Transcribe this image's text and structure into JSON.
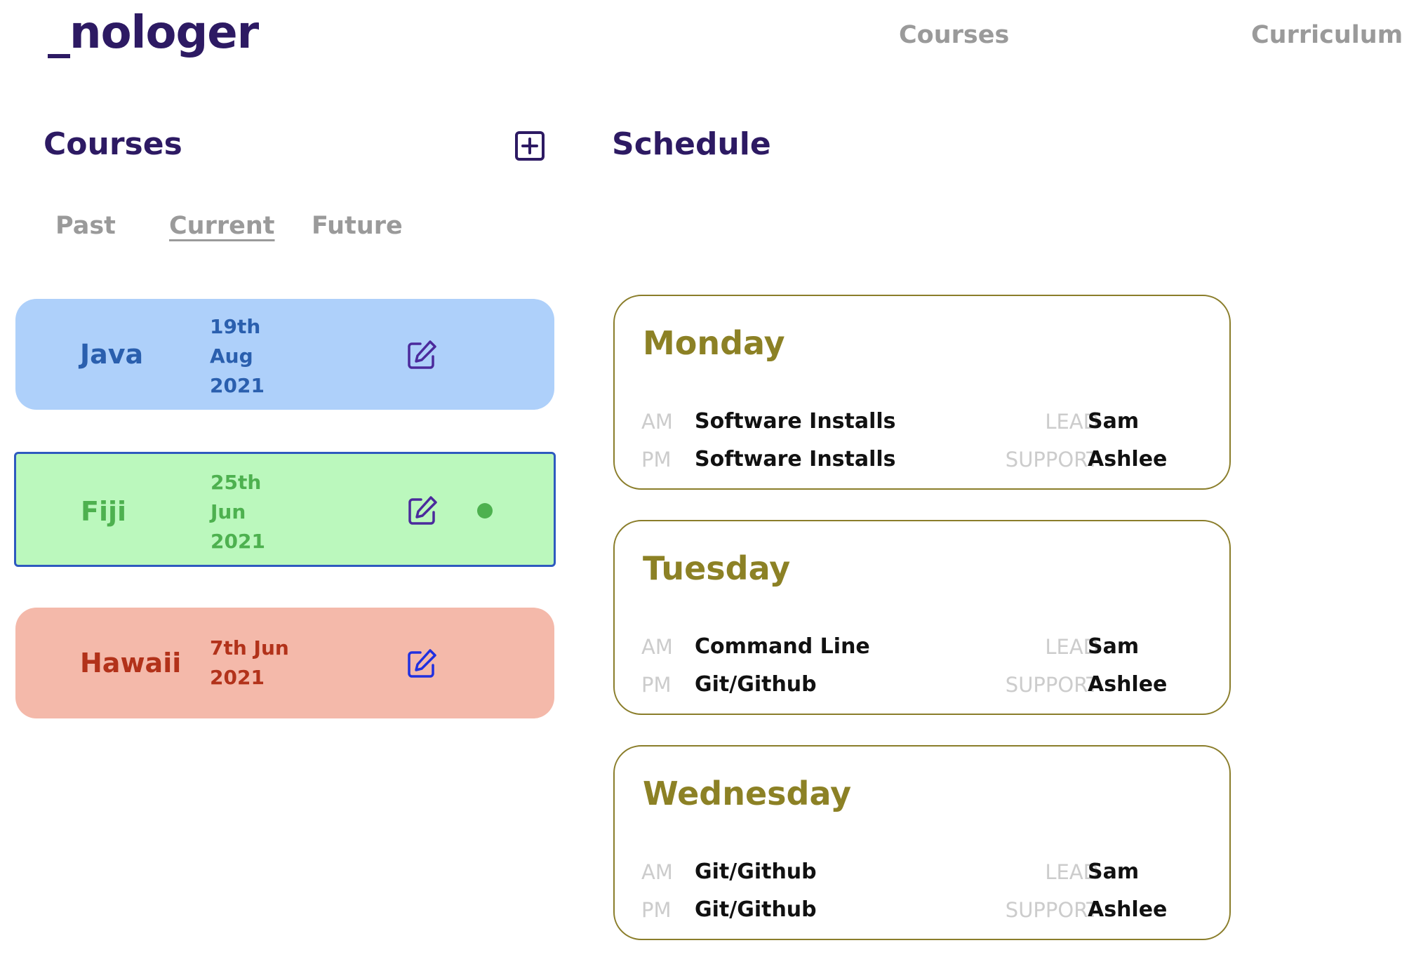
{
  "header": {
    "logo": "_nologer",
    "nav": {
      "courses": "Courses",
      "curriculum": "Curriculum"
    }
  },
  "courses_panel": {
    "title": "Courses",
    "tabs": {
      "past": "Past",
      "current": "Current",
      "future": "Future"
    },
    "cards": [
      {
        "name": "Java",
        "date_line1": "19th",
        "date_line2": "Aug",
        "date_line3": "2021"
      },
      {
        "name": "Fiji",
        "date_line1": "25th",
        "date_line2": "Jun",
        "date_line3": "2021"
      },
      {
        "name": "Hawaii",
        "date_line1": "7th Jun",
        "date_line2": "2021"
      }
    ]
  },
  "schedule": {
    "title": "Schedule",
    "labels": {
      "am": "AM",
      "pm": "PM",
      "lead": "LEAD",
      "support": "SUPPORT"
    },
    "days": [
      {
        "day": "Monday",
        "am": "Software Installs",
        "pm": "Software Installs",
        "lead": "Sam",
        "support": "Ashlee"
      },
      {
        "day": "Tuesday",
        "am": "Command Line",
        "pm": "Git/Github",
        "lead": "Sam",
        "support": "Ashlee"
      },
      {
        "day": "Wednesday",
        "am": "Git/Github",
        "pm": "Git/Github",
        "lead": "Sam",
        "support": "Ashlee"
      }
    ]
  },
  "colors": {
    "brand": "#2d1a63",
    "java_bg": "#aed0fa",
    "java_text": "#2a5fae",
    "fiji_bg": "#bbf8bd",
    "fiji_text": "#4db14f",
    "fiji_border": "#2e5abf",
    "hawaii_bg": "#f4b9aa",
    "hawaii_text": "#b2321a",
    "schedule_accent": "#8c8125"
  },
  "icons": {
    "add": "plus-square-icon",
    "edit": "edit-pencil-icon",
    "status": "active-status-dot-icon"
  }
}
